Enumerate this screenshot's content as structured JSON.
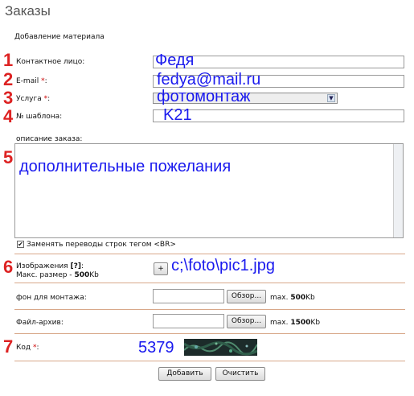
{
  "page": {
    "title": "Заказы",
    "subtitle": "Добавление материала"
  },
  "markers": [
    "1",
    "2",
    "3",
    "4",
    "5",
    "6",
    "7"
  ],
  "contact": {
    "label": "Контактное лицо:",
    "value": "Федя"
  },
  "email": {
    "label": "E-mail",
    "required": "*",
    "colon": ":",
    "value": "fedya@mail.ru"
  },
  "service": {
    "label": "Услуга",
    "required": "*",
    "colon": ":",
    "selected": "фотомонтаж"
  },
  "template": {
    "label": "№ шаблона:",
    "value": "K21"
  },
  "description": {
    "label": "описание заказа:",
    "value": "дополнительные пожелания"
  },
  "br_option": {
    "label": "Заменять переводы строк тегом <BR>",
    "checked": true,
    "check_glyph": "✔"
  },
  "images": {
    "label": "Изображения",
    "help": "[?]",
    "colon": ":",
    "size_note": "Макс. размер -",
    "size_value": "500",
    "size_unit": "Kb",
    "add_button": "+",
    "path": "c;\\foto\\pic1.jpg"
  },
  "background": {
    "label": "фон для монтажа:",
    "browse": "Обзор...",
    "max_prefix": "max.",
    "max_value": "500",
    "max_unit": "Kb"
  },
  "archive": {
    "label": "Файл-архив:",
    "browse": "Обзор...",
    "max_prefix": "max.",
    "max_value": "1500",
    "max_unit": "Kb"
  },
  "code": {
    "label": "Код",
    "required": "*",
    "colon": ":",
    "value": "5379"
  },
  "actions": {
    "submit": "Добавить",
    "reset": "Очистить"
  },
  "colors": {
    "marker": "#dd2222",
    "annotation": "#1a1aee",
    "separator": "#d8a88a",
    "required": "#cc0000"
  }
}
